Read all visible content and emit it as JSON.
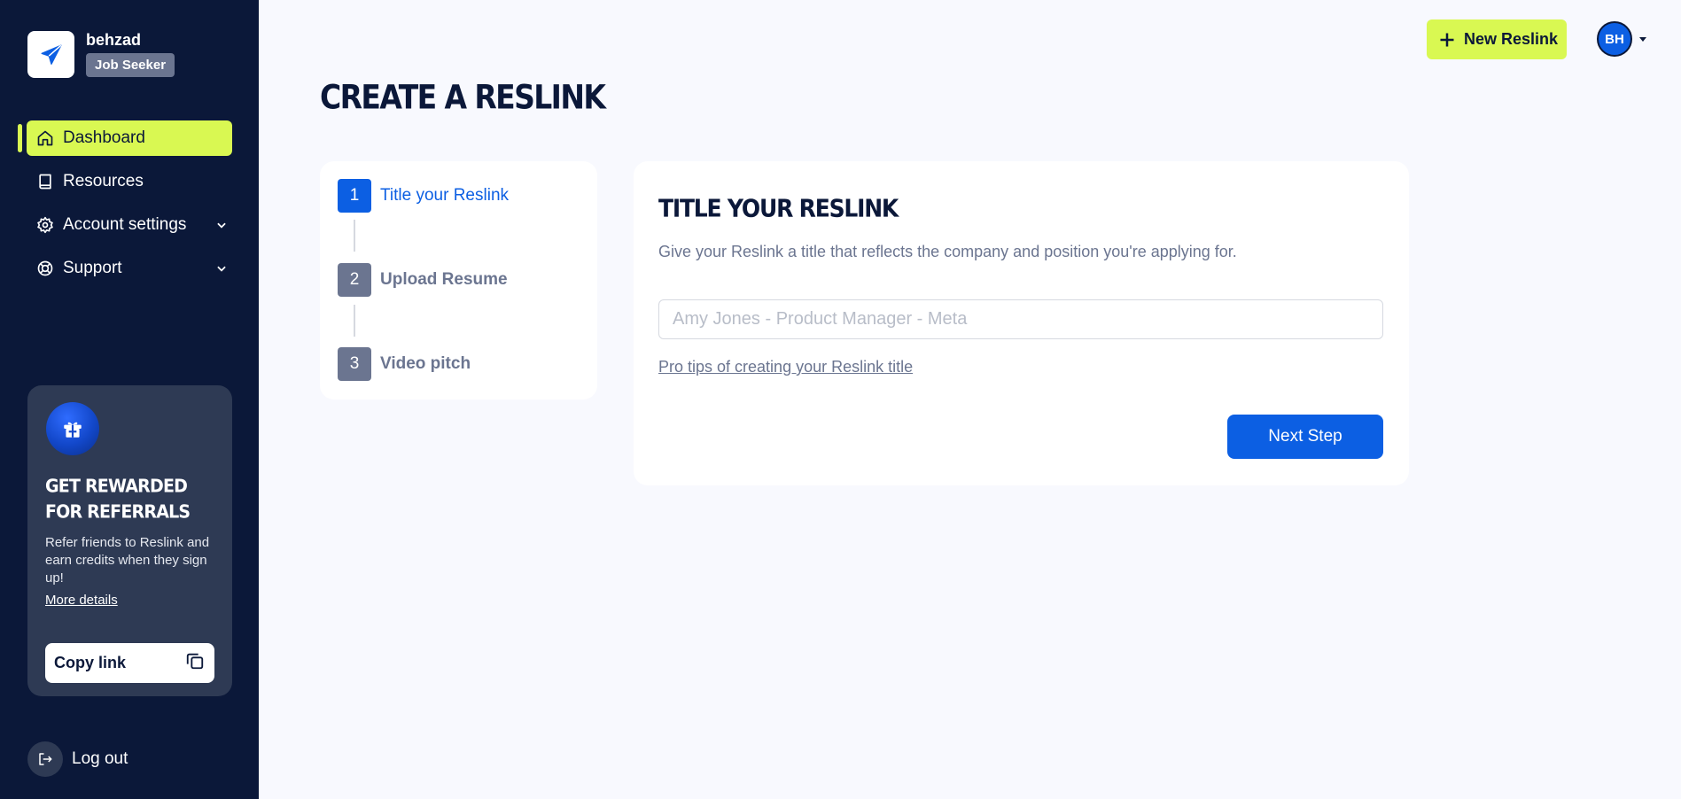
{
  "profile": {
    "name": "behzad",
    "role": "Job Seeker"
  },
  "nav": {
    "items": [
      {
        "label": "Dashboard",
        "icon": "home-icon",
        "active": true
      },
      {
        "label": "Resources",
        "icon": "book-icon"
      },
      {
        "label": "Account settings",
        "icon": "gear-icon"
      },
      {
        "label": "Support",
        "icon": "lifebuoy-icon"
      }
    ]
  },
  "referral": {
    "title": "GET REWARDED FOR REFERRALS",
    "description": "Refer friends to Reslink and earn credits when they sign up!",
    "more_link": "More details",
    "copy_label": "Copy link"
  },
  "logout_label": "Log out",
  "header": {
    "new_button": "New Reslink",
    "avatar_initials": "BH"
  },
  "page_title": "CREATE A RESLINK",
  "steps": [
    {
      "number": "1",
      "label": "Title your Reslink",
      "active": true
    },
    {
      "number": "2",
      "label": "Upload Resume"
    },
    {
      "number": "3",
      "label": "Video pitch"
    }
  ],
  "form": {
    "title": "TITLE YOUR RESLINK",
    "description": "Give your Reslink a title that reflects the company and position you're applying for.",
    "input_placeholder": "Amy Jones - Product Manager - Meta",
    "input_value": "",
    "tips_link": "Pro tips of creating your Reslink title",
    "next_button": "Next Step"
  },
  "colors": {
    "sidebar_bg": "#0b1839",
    "accent_lime": "#d9f852",
    "primary_blue": "#0c5fe3",
    "muted_gray": "#6b7590"
  }
}
